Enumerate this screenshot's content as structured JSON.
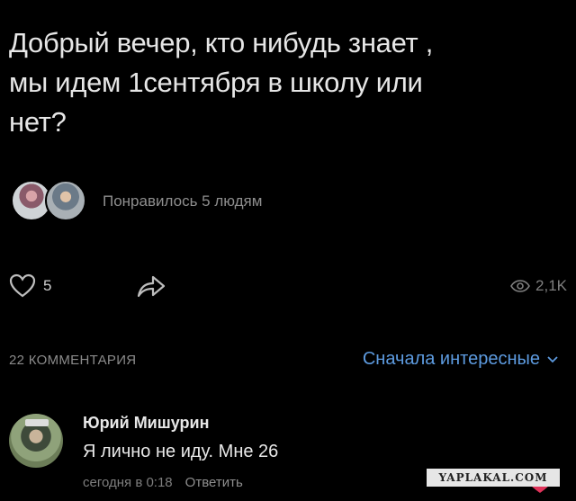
{
  "post": {
    "text_line1": "Добрый вечер, кто нибудь знает ,",
    "text_line2": "мы идем 1сентября в школу или",
    "text_line3": "нет?"
  },
  "likes": {
    "summary": "Понравилось 5 людям"
  },
  "actions": {
    "like_count": "5",
    "views": "2,1K"
  },
  "comments_header": {
    "count_label": "22 КОММЕНТАРИЯ",
    "sort_label": "Сначала интересные"
  },
  "comment": {
    "author": "Юрий Мишурин",
    "text": "Я лично не иду. Мне 26",
    "timestamp": "сегодня в 0:18",
    "reply_label": "Ответить"
  },
  "watermark": {
    "text": "YAPLAKAL.COM"
  },
  "colors": {
    "background": "#000000",
    "text": "#e6e6e6",
    "muted": "#8e8e8e",
    "link_blue": "#5d9be0",
    "heart_red": "#e0335a"
  },
  "icons": [
    "heart-icon",
    "share-icon",
    "eye-icon",
    "chevron-down-icon"
  ]
}
